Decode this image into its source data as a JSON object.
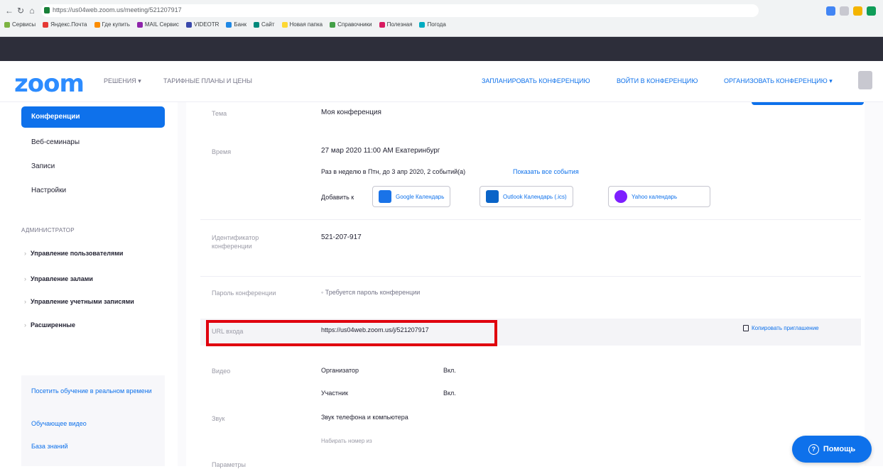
{
  "browser": {
    "url": "https://us04web.zoom.us/meeting/521207917",
    "bookmarks": [
      "Сервисы",
      "Яндекс.Почта",
      "Где купить",
      "MAIL Сервис",
      "VIDEOTR",
      "Банк",
      "Сайт",
      "Новая папка",
      "Справочники",
      "Полезная",
      "Погода"
    ]
  },
  "header": {
    "logo": "zoom",
    "nav_solutions": "РЕШЕНИЯ ▾",
    "nav_plans": "ТАРИФНЫЕ ПЛАНЫ И ЦЕНЫ",
    "nav_schedule": "ЗАПЛАНИРОВАТЬ КОНФЕРЕНЦИЮ",
    "nav_join": "ВОЙТИ В КОНФЕРЕНЦИЮ",
    "nav_host": "ОРГАНИЗОВАТЬ КОНФЕРЕНЦИЮ ▾"
  },
  "sidebar": {
    "active": "Конференции",
    "items": [
      "Веб-семинары",
      "Записи",
      "Настройки"
    ],
    "admin_title": "АДМИНИСТРАТОР",
    "admin_items": [
      "Управление пользователями",
      "Управление залами",
      "Управление учетными записями",
      "Расширенные"
    ],
    "links": [
      "Посетить обучение в реальном времени",
      "Обучающее видео",
      "База знаний"
    ]
  },
  "meeting": {
    "topic_label": "Тема",
    "topic_value": "Моя конференция",
    "time_label": "Время",
    "time_value": "27 мар 2020 11:00 AM Екатеринбург",
    "recurrence": "Раз в неделю в Птн, до 3 апр 2020, 2 событий(а)",
    "show_all": "Показать все события",
    "add_to": "Добавить к",
    "cal_google": "Google Календарь",
    "cal_outlook": "Outlook Календарь (.ics)",
    "cal_yahoo": "Yahoo календарь",
    "id_label": "Идентификатор конференции",
    "id_value": "521-207-917",
    "password_label": "Пароль конференции",
    "password_value": "Требуется пароль конференции",
    "url_label": "URL входа",
    "url_value": "https://us04web.zoom.us/j/521207917",
    "copy_invite": "Копировать приглашение",
    "video_label": "Видео",
    "video_host": "Организатор",
    "video_host_val": "Вкл.",
    "video_participant": "Участник",
    "video_participant_val": "Вкл.",
    "audio_label": "Звук",
    "audio_value": "Звук телефона и компьютера",
    "dial_in": "Набирать номер из",
    "options_label": "Параметры"
  },
  "help": "Помощь",
  "colors": {
    "accent": "#0e71eb",
    "highlight": "#e0000e"
  }
}
